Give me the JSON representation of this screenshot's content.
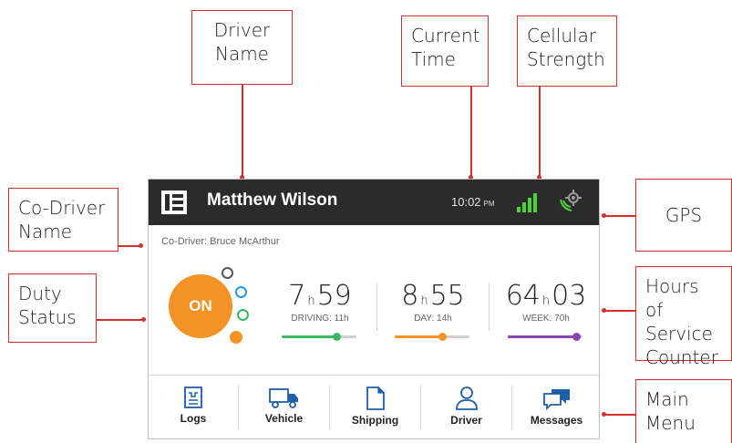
{
  "callouts": {
    "driver_name": [
      "Driver",
      "Name"
    ],
    "current_time": [
      "Current",
      "Time"
    ],
    "cellular_strength": [
      "Cellular",
      "Strength"
    ],
    "co_driver_name": [
      "Co-Driver",
      "Name"
    ],
    "gps": [
      "GPS"
    ],
    "duty_status": [
      "Duty",
      "Status"
    ],
    "hours_of_service": [
      "Hours of",
      "Service",
      "Counter"
    ],
    "main_menu": [
      "Main",
      "Menu"
    ]
  },
  "topbar": {
    "driver_name": "Matthew Wilson",
    "time": "10:02",
    "ampm": "PM",
    "logo_icon": "eld-logo-icon",
    "signal_icon": "cellular-signal-icon",
    "gps_icon": "gps-icon"
  },
  "codriver": "Co-Driver: Bruce McArthur",
  "duty": {
    "status": "ON",
    "color": "#f39325"
  },
  "counters": [
    {
      "hours": "7",
      "minutes": "59",
      "unit": "h",
      "label": "DRIVING: 11h",
      "color": "#3cb95c",
      "progress": 0.73
    },
    {
      "hours": "8",
      "minutes": "55",
      "unit": "h",
      "label": "DAY: 14h",
      "color": "#f39325",
      "progress": 0.64
    },
    {
      "hours": "64",
      "minutes": "03",
      "unit": "h",
      "label": "WEEK: 70h",
      "color": "#8e44ad",
      "progress": 0.92
    }
  ],
  "menu": [
    {
      "label": "Logs",
      "icon": "logs-icon"
    },
    {
      "label": "Vehicle",
      "icon": "truck-icon"
    },
    {
      "label": "Shipping",
      "icon": "document-icon"
    },
    {
      "label": "Driver",
      "icon": "person-icon"
    },
    {
      "label": "Messages",
      "icon": "chat-icon"
    }
  ],
  "colors": {
    "accent_blue": "#1f5fa8",
    "callout_red": "#d32f2f",
    "topbar": "#2b2b2b"
  }
}
